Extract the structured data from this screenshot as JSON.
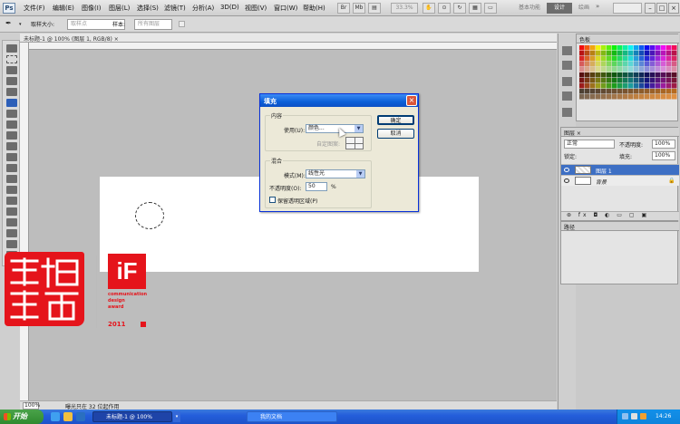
{
  "menubar": {
    "logo": "Ps",
    "items": [
      "文件(F)",
      "编辑(E)",
      "图像(I)",
      "图层(L)",
      "选择(S)",
      "滤镜(T)",
      "分析(A)",
      "3D(D)",
      "视图(V)",
      "窗口(W)",
      "帮助(H)"
    ],
    "zoom": "33.3%",
    "workspaces": {
      "basic": "基本功能",
      "design": "设计",
      "paint": "绘画",
      "more": "»"
    }
  },
  "options": {
    "sample_size_label": "取样大小:",
    "sample_size_value": "取样点",
    "sample_label": "样本:",
    "sample_value": "所有图层"
  },
  "document": {
    "tab_title": "未标题-1 @ 100% (图层 1, RGB/8) ×",
    "zoom": "100%",
    "info": "曝光只在 32 位起作用"
  },
  "logos": {
    "if_text": "iF",
    "if_lines": [
      "communication",
      "design",
      "award"
    ],
    "if_year": "2011"
  },
  "panels": {
    "swatches_tab": "色板",
    "layers_tab": "图层 ×",
    "blend_mode": "正常",
    "opacity_label": "不透明度:",
    "opacity_value": "100%",
    "lock_label": "锁定:",
    "fill_label": "填充:",
    "fill_value": "100%",
    "layers": [
      {
        "name": "图层 1"
      },
      {
        "name": "背景"
      }
    ],
    "layers_bottom_icons": "⊛ fx ◘ ◐ ▭ ▢ ▣",
    "paths_tab": "路径"
  },
  "dialog": {
    "title": "填充",
    "contents_legend": "内容",
    "use_label": "使用(U):",
    "use_value": "颜色...",
    "custom_pattern_label": "自定图案:",
    "ok": "确定",
    "cancel": "取消",
    "blending_legend": "混合",
    "mode_label": "模式(M):",
    "mode_value": "线性光",
    "opacity_label": "不透明度(O):",
    "opacity_value": "50",
    "opacity_unit": "%",
    "preserve_label": "保留透明区域(P)"
  },
  "taskbar": {
    "start": "开始",
    "task_ps": "未标题-1 @ 100%",
    "task_folder": "我的文档",
    "clock": "14:26"
  },
  "colors": {
    "accent": "#e5141b",
    "selection_blue": "#3d6fc4",
    "dialog_title": "#0a5fd8"
  }
}
